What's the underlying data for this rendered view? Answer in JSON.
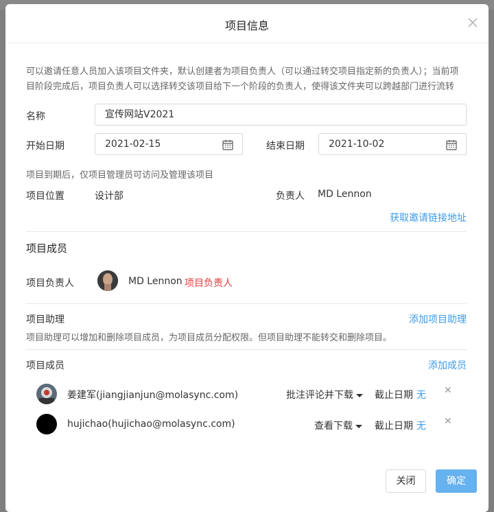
{
  "dialog": {
    "title": "项目信息",
    "description": "可以邀请任意人员加入该项目文件夹，默认创建者为项目负责人（可以通过转交项目指定新的负责人）；当前项目阶段完成后，项目负责人可以选择转交该项目给下一个阶段的负责人，使得该文件夹可以跨越部门进行流转"
  },
  "form": {
    "name_label": "名称",
    "name_value": "宣传网站V2021",
    "start_label": "开始日期",
    "start_value": "2021-02-15",
    "end_label": "结束日期",
    "end_value": "2021-10-02",
    "expire_note": "项目到期后，仅项目管理员可访问及管理该项目",
    "location_label": "项目位置",
    "location_value": "设计部",
    "owner_label": "负责人",
    "owner_value": "MD Lennon",
    "invite_link": "获取邀请链接地址"
  },
  "members": {
    "section_title": "项目成员",
    "owner_label": "项目负责人",
    "owner_name": "MD Lennon",
    "owner_badge": "项目负责人",
    "assistant_label": "项目助理",
    "add_assistant": "添加项目助理",
    "assistant_note": "项目助理可以增加和删除项目成员，为项目成员分配权限。但项目助理不能转交和删除项目。",
    "member_label": "项目成员",
    "add_member": "添加成员",
    "list": [
      {
        "name": "姜建军(jiangjianjun@molasync.com)",
        "permission": "批注评论并下载",
        "deadline_label": "截止日期",
        "deadline_value": "无"
      },
      {
        "name": "hujichao(hujichao@molasync.com)",
        "permission": "查看下载",
        "deadline_label": "截止日期",
        "deadline_value": "无"
      }
    ]
  },
  "footer": {
    "close_label": "关闭",
    "confirm_label": "确定"
  },
  "colors": {
    "accent": "#3d9be9",
    "primary_button": "#66b1ef",
    "owner_badge": "#e03c3c"
  }
}
